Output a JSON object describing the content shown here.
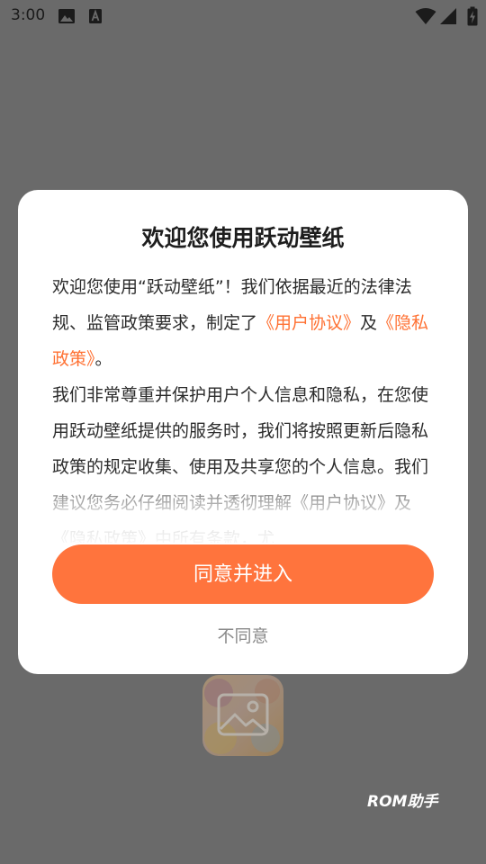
{
  "status_bar": {
    "time": "3:00",
    "icons": [
      "image-notification-icon",
      "a-notification-icon",
      "wifi-icon",
      "signal-icon",
      "battery-icon"
    ]
  },
  "dialog": {
    "title": "欢迎您使用跃动壁纸",
    "paragraph1": {
      "intro": "欢迎您使用“跃动壁纸”！我们依据最近的法律法规、监管政策要求，制定了",
      "user_agreement_link": "《用户协议》",
      "and": "及",
      "privacy_policy_link": "《隐私政策》",
      "end": "。"
    },
    "paragraph2": {
      "text": "我们非常尊重并保护用户个人信息和隐私，在您使用跃动壁纸提供的服务时，我们将按照更新后隐私政策的规定收集、使用及共享您的个人信息。我们建议您务必仔细阅读并透彻理解",
      "user_agreement_link": "《用户协议》",
      "and": "及",
      "privacy_policy_link": "《隐私政策》",
      "tail": "中所有条款，尤"
    },
    "agree_button": "同意并进入",
    "disagree_button": "不同意"
  },
  "background": {
    "watermark": "ROM助手",
    "app_icon": "wallpaper-app-icon"
  },
  "colors": {
    "accent": "#ff743d",
    "link": "#ff7133",
    "overlay": "#6a6a6a",
    "dialog_bg": "#ffffff"
  }
}
